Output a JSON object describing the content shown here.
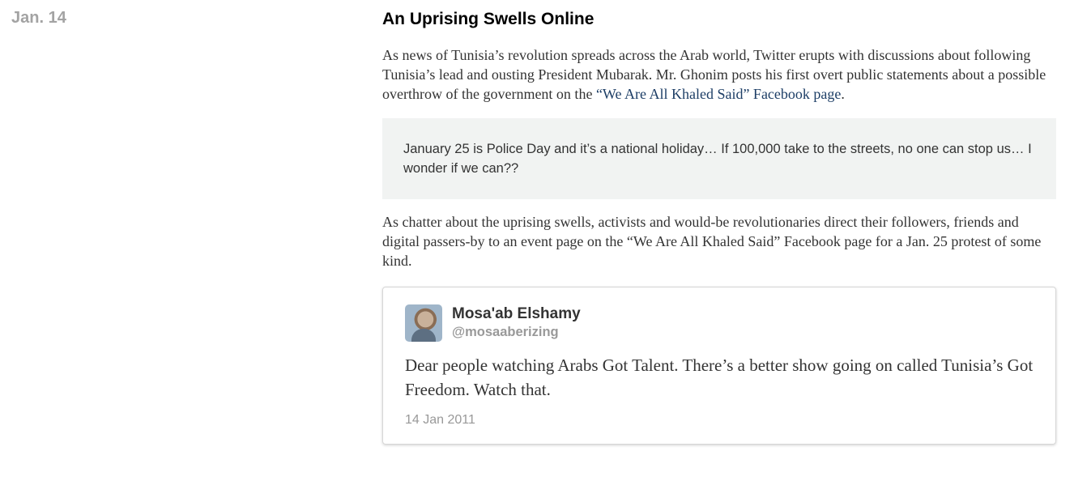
{
  "timeline": {
    "date": "Jan. 14"
  },
  "entry": {
    "headline": "An Uprising Swells Online",
    "para1_before": "As news of Tunisia’s revolution spreads across the Arab world, Twitter erupts with discussions about following Tunisia’s lead and ousting President Mubarak. Mr. Ghonim posts his first overt public statements about a possible overthrow of the government on the ",
    "para1_link": "“We Are All Khaled Said” Facebook page",
    "para1_after": ".",
    "quote": "January 25 is Police Day and it’s a national holiday… If 100,000 take to the streets, no one can stop us… I wonder if we can??",
    "para2": "As chatter about the uprising swells, activists and would-be revolutionaries direct their followers, friends and digital passers-by to an event page on the “We Are All Khaled Said” Facebook page for a Jan. 25 protest of some kind."
  },
  "tweet": {
    "name": "Mosa'ab Elshamy",
    "handle": "@mosaaberizing",
    "text": "Dear people watching Arabs Got Talent. There’s a better show going on called Tunisia’s Got Freedom. Watch that.",
    "date": "14 Jan 2011"
  },
  "colors": {
    "link": "#1d3e66",
    "quote_bg": "#f1f3f2",
    "muted": "#a3a3a3"
  }
}
